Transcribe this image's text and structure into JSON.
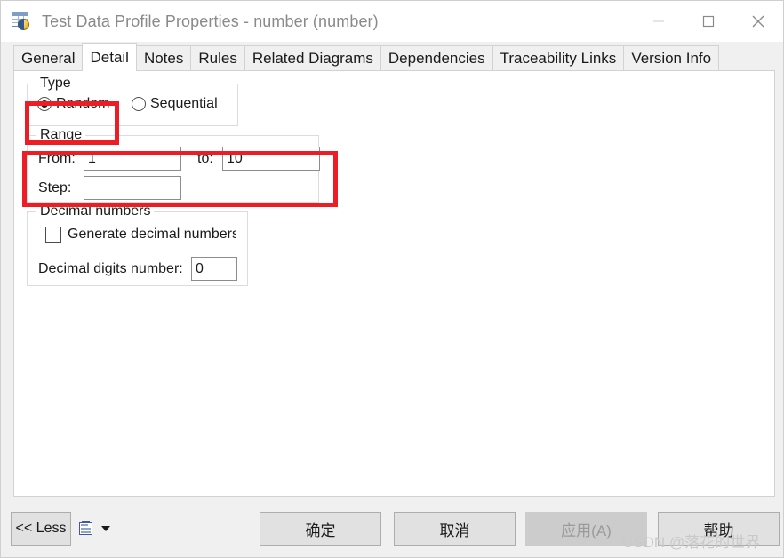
{
  "window": {
    "title": "Test Data Profile Properties - number (number)",
    "icon": "table-profile-icon",
    "controls": {
      "minimize": "minimize-icon",
      "maximize": "maximize-icon",
      "close": "close-icon"
    }
  },
  "tabs": [
    {
      "label": "General",
      "selected": false
    },
    {
      "label": "Detail",
      "selected": true
    },
    {
      "label": "Notes",
      "selected": false
    },
    {
      "label": "Rules",
      "selected": false
    },
    {
      "label": "Related Diagrams",
      "selected": false
    },
    {
      "label": "Dependencies",
      "selected": false
    },
    {
      "label": "Traceability Links",
      "selected": false
    },
    {
      "label": "Version Info",
      "selected": false
    }
  ],
  "detail": {
    "type_group": {
      "title": "Type",
      "options": [
        {
          "label": "Random",
          "checked": true
        },
        {
          "label": "Sequential",
          "checked": false
        }
      ]
    },
    "range_group": {
      "title": "Range",
      "from_label": "From:",
      "from_value": "1",
      "to_label": "to:",
      "to_value": "10",
      "step_label": "Step:",
      "step_value": "",
      "placeholder": ""
    },
    "decimal_group": {
      "title": "Decimal numbers",
      "generate_label": "Generate decimal numbers",
      "generate_checked": false,
      "digits_label": "Decimal digits number:",
      "digits_value": "0"
    }
  },
  "annotations": [
    {
      "name": "type-highlight",
      "color": "#ee1c25"
    },
    {
      "name": "range-highlight",
      "color": "#ee1c25"
    }
  ],
  "footer": {
    "less_label": "<< Less",
    "print_icon": "print-icon",
    "dropdown_icon": "chevron-down-icon",
    "ok_label": "确定",
    "cancel_label": "取消",
    "apply_label": "应用(A)",
    "apply_disabled": true,
    "help_label": "帮助"
  },
  "watermark": "CSDN @落花的世界"
}
